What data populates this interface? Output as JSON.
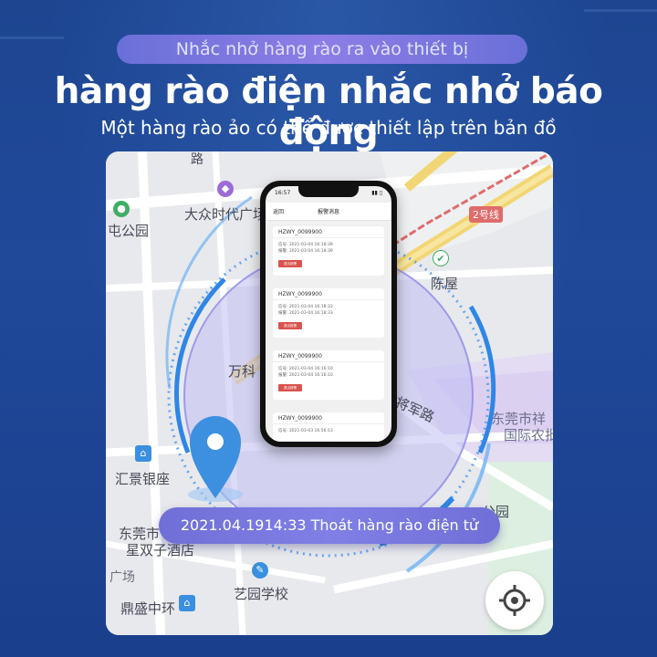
{
  "header": {
    "pill_text": "Nhắc nhở hàng rào ra vào thiết bị",
    "headline": "hàng rào điện  nhắc nhở báo động",
    "subtitle": "Một hàng rào ảo có thể được thiết lập trên bản đồ"
  },
  "map": {
    "places": {
      "top_road": "路",
      "plaza": "大众时代广场",
      "park_left": "屯公园",
      "line2": "2号线",
      "chenwu": "陈屋",
      "wanke": "万科",
      "road_jiangjun": "将军路",
      "dongguan_right": "东莞市祥",
      "intl_farm": "国际农批",
      "huijing": "汇景银座",
      "park_bottom": "公园",
      "dongguan_bottom": "东莞市",
      "hotel": "星双子酒店",
      "guang": "广场",
      "yiyuan": "艺园学校",
      "dingsheng": "鼎盛中环"
    }
  },
  "phone": {
    "status_time": "16:57",
    "nav_back": "返回",
    "nav_title": "报警消息",
    "cards": [
      {
        "id": "HZWY_0099900",
        "line1": "信号: 2021-03-04 16:18:39",
        "line2": "报警: 2021-03-04 16:18:39",
        "button": "退出报警"
      },
      {
        "id": "HZWY_0099900",
        "line1": "信号: 2021-03-04 16:18:33",
        "line2": "报警: 2021-03-04 16:18:33",
        "button": "退出报警"
      },
      {
        "id": "HZWY_0099900",
        "line1": "信号: 2021-03-04 16:16:10",
        "line2": "报警: 2021-03-04 16:16:10",
        "button": "退出报警"
      },
      {
        "id": "HZWY_0099900",
        "line1": "信号: 2021-03-03 16:56:13",
        "line2": "",
        "button": ""
      }
    ]
  },
  "banner": {
    "text": "2021.04.1914:33 Thoát hàng rào điện tử"
  },
  "icons": {
    "location_pin": "location-pin-icon",
    "locate": "crosshair-icon",
    "bank": "bank-icon",
    "shopping": "shopping-bag-icon"
  },
  "colors": {
    "background": "#1f4897",
    "pill": "#7b78e0",
    "fence": "#4f8fe6",
    "pin": "#3d8fe0",
    "alarm_button": "#d9534f"
  }
}
